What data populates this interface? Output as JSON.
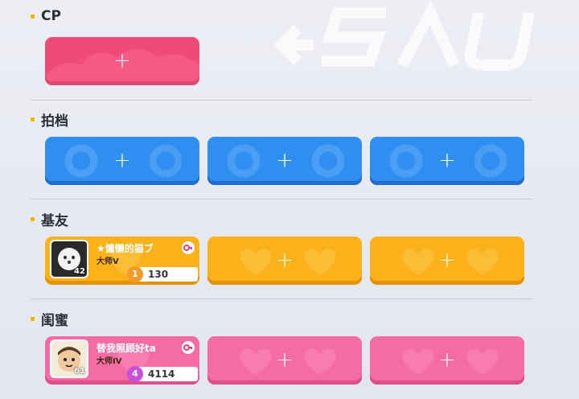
{
  "sections": [
    {
      "title": "CP"
    },
    {
      "title": "拍档"
    },
    {
      "title": "基友"
    },
    {
      "title": "闺蜜"
    }
  ],
  "empty_slot_label": "+",
  "jiyou_filled": {
    "name": "★慵懒的猫ブ",
    "rank": "大师V",
    "level": "42",
    "score_icon_text": "1",
    "score": "130"
  },
  "guimi_filled": {
    "name": "替我照顾好ta",
    "rank": "大师IV",
    "level": "61",
    "score_icon_text": "4",
    "score": "4114"
  },
  "colors": {
    "cp": "#ee4b78",
    "paidang": "#2f8ef0",
    "jiyou": "#fbb21a",
    "guimi": "#f46ba6"
  }
}
